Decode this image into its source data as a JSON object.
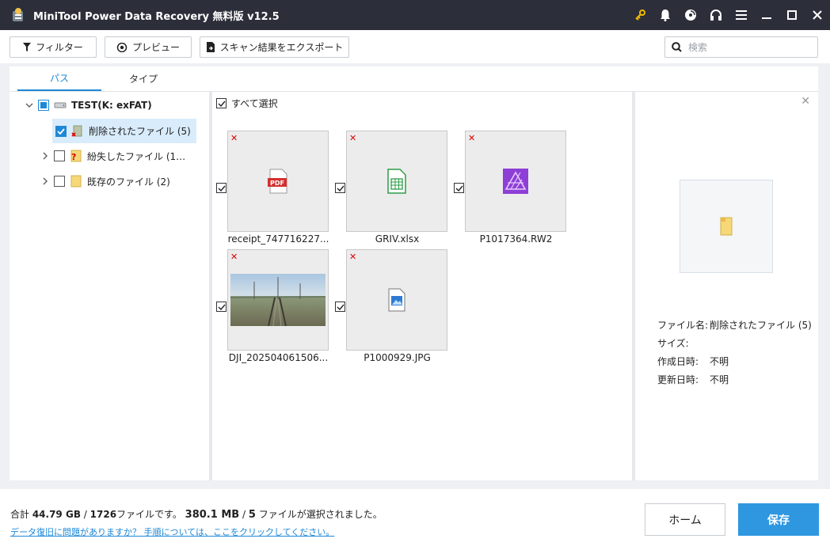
{
  "app": {
    "title": "MiniTool Power Data Recovery 無料版 v12.5"
  },
  "toolbar": {
    "filter_label": "フィルター",
    "preview_label": "プレビュー",
    "export_label": "スキャン結果をエクスポート",
    "search_placeholder": "検索"
  },
  "tabs": [
    {
      "label": "パス",
      "active": true
    },
    {
      "label": "タイプ",
      "active": false
    }
  ],
  "tree": {
    "root": {
      "label": "TEST(K: exFAT)"
    },
    "items": [
      {
        "label": "削除されたファイル (5)",
        "checked": true,
        "selected": true
      },
      {
        "label": "紛失したファイル (17...",
        "checked": false
      },
      {
        "label": "既存のファイル (2)",
        "checked": false
      }
    ]
  },
  "grid": {
    "select_all_label": "すべて選択",
    "files": [
      {
        "name": "receipt_747716227...",
        "type": "pdf",
        "deleted": true,
        "checked": true
      },
      {
        "name": "GRIV.xlsx",
        "type": "xlsx",
        "deleted": true,
        "checked": true
      },
      {
        "name": "P1017364.RW2",
        "type": "rw2",
        "deleted": true,
        "checked": true
      },
      {
        "name": "DJI_202504061506...",
        "type": "photo",
        "deleted": true,
        "checked": true
      },
      {
        "name": "P1000929.JPG",
        "type": "jpg",
        "deleted": true,
        "checked": true
      }
    ]
  },
  "preview": {
    "rows": [
      {
        "key": "ファイル名:",
        "value": "削除されたファイル (5)"
      },
      {
        "key": "サイズ:",
        "value": ""
      },
      {
        "key": "作成日時:",
        "value": "不明"
      },
      {
        "key": "更新日時:",
        "value": "不明"
      }
    ]
  },
  "footer": {
    "summary_prefix": "合計 ",
    "total_size": "44.79 GB",
    "sep1": " / ",
    "total_files": "1726",
    "summary_mid": "ファイルです。 ",
    "selected_size": "380.1 MB",
    "sep2": " / ",
    "selected_count": "5",
    "summary_suffix": " ファイルが選択されました。",
    "help_link": "データ復旧に問題がありますか？ 手順については、ここをクリックしてください。",
    "home_label": "ホーム",
    "save_label": "保存"
  },
  "colors": {
    "accent": "#1e88d6",
    "titlebar": "#2c2f3a",
    "save": "#2e97e0",
    "deleted": "#dd0000"
  }
}
